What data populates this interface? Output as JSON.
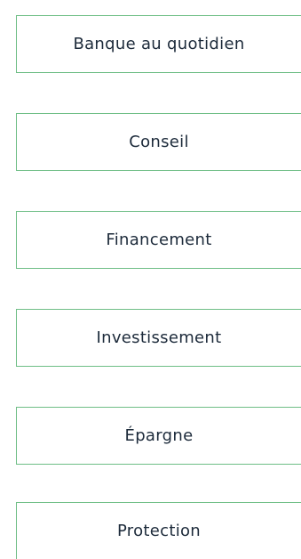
{
  "theme": {
    "border_color": "#6fbe86",
    "text_color": "#1c2a3a",
    "background": "#ffffff"
  },
  "menu": {
    "items": [
      {
        "label": "Banque au quotidien"
      },
      {
        "label": "Conseil"
      },
      {
        "label": "Financement"
      },
      {
        "label": "Investissement"
      },
      {
        "label": "Épargne"
      },
      {
        "label": "Protection"
      }
    ]
  }
}
